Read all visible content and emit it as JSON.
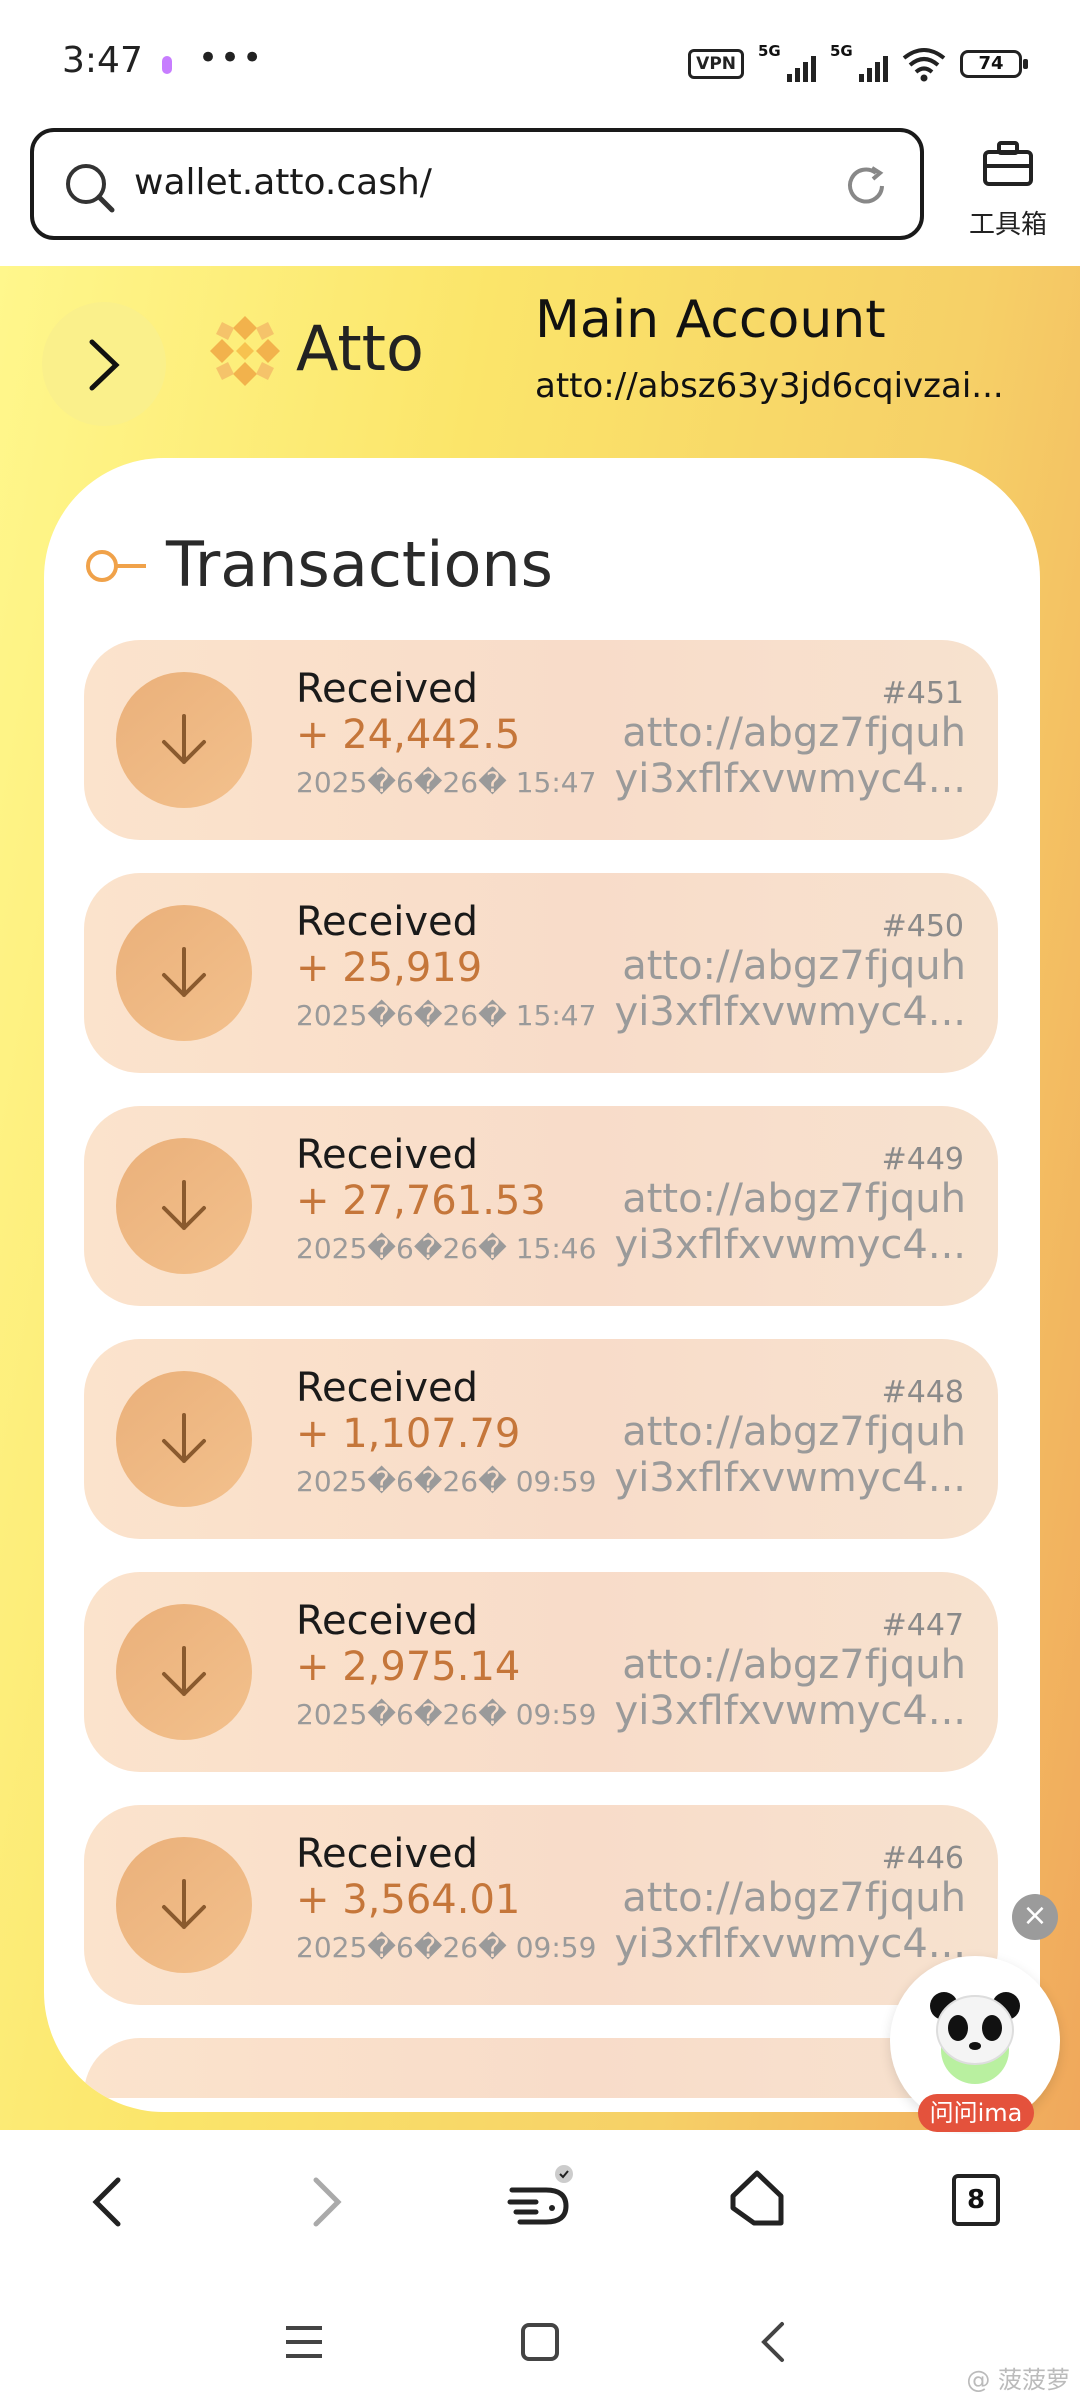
{
  "status_bar": {
    "time": "3:47",
    "more": "•••",
    "vpn": "VPN",
    "signal1": "5G",
    "signal2": "5G",
    "battery": "74"
  },
  "browser": {
    "url": "wallet.atto.cash/",
    "toolbox_label": "工具箱",
    "tab_count": "8"
  },
  "header": {
    "brand": "Atto",
    "account_title": "Main Account",
    "account_address": "atto://absz63y3jd6cqivzai..."
  },
  "transactions": {
    "title": "Transactions",
    "items": [
      {
        "type": "Received",
        "amount": "+ 24,442.5",
        "date": "2025�6�26� 15:47",
        "number": "#451",
        "addr1": "atto://abgz7fjquh",
        "addr2": "yi3xflfxvwmyc4..."
      },
      {
        "type": "Received",
        "amount": "+ 25,919",
        "date": "2025�6�26� 15:47",
        "number": "#450",
        "addr1": "atto://abgz7fjquh",
        "addr2": "yi3xflfxvwmyc4..."
      },
      {
        "type": "Received",
        "amount": "+ 27,761.53",
        "date": "2025�6�26� 15:46",
        "number": "#449",
        "addr1": "atto://abgz7fjquh",
        "addr2": "yi3xflfxvwmyc4..."
      },
      {
        "type": "Received",
        "amount": "+ 1,107.79",
        "date": "2025�6�26� 09:59",
        "number": "#448",
        "addr1": "atto://abgz7fjquh",
        "addr2": "yi3xflfxvwmyc4..."
      },
      {
        "type": "Received",
        "amount": "+ 2,975.14",
        "date": "2025�6�26� 09:59",
        "number": "#447",
        "addr1": "atto://abgz7fjquh",
        "addr2": "yi3xflfxvwmyc4..."
      },
      {
        "type": "Received",
        "amount": "+ 3,564.01",
        "date": "2025�6�26� 09:59",
        "number": "#446",
        "addr1": "atto://abgz7fjquh",
        "addr2": "yi3xflfxvwmyc4..."
      }
    ]
  },
  "assistant": {
    "label": "问问ima",
    "close": "×"
  },
  "watermark": "@ 菠菠萝",
  "colors": {
    "accent": "#c5763a",
    "badge": "#e4523c"
  }
}
